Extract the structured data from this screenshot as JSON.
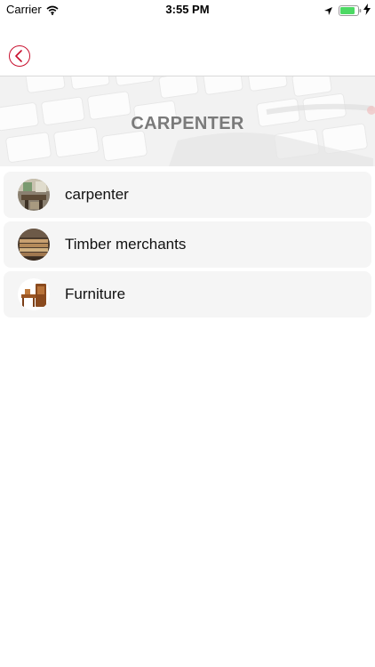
{
  "status_bar": {
    "carrier": "Carrier",
    "time": "3:55 PM",
    "icons": [
      "wifi-icon",
      "location-arrow-icon",
      "battery-icon",
      "charging-bolt-icon"
    ]
  },
  "nav": {
    "back_icon": "chevron-left-icon",
    "accent_color": "#c8102e"
  },
  "banner": {
    "title": "CARPENTER"
  },
  "categories": [
    {
      "label": "carpenter",
      "thumbnail": "workshop-thumbnail"
    },
    {
      "label": "Timber merchants",
      "thumbnail": "timber-thumbnail"
    },
    {
      "label": "Furniture",
      "thumbnail": "furniture-thumbnail"
    }
  ]
}
